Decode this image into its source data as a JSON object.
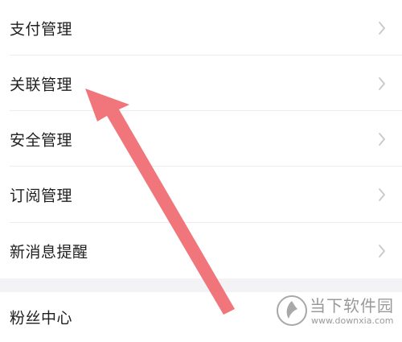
{
  "menu": {
    "items": [
      {
        "label": "支付管理",
        "icon": "chevron-right-icon"
      },
      {
        "label": "关联管理",
        "icon": "chevron-right-icon"
      },
      {
        "label": "安全管理",
        "icon": "chevron-right-icon"
      },
      {
        "label": "订阅管理",
        "icon": "chevron-right-icon"
      },
      {
        "label": "新消息提醒",
        "icon": "chevron-right-icon"
      }
    ],
    "secondary_items": [
      {
        "label": "粉丝中心"
      }
    ]
  },
  "annotation": {
    "icon": "red-arrow-pointer",
    "color": "#f06a70"
  },
  "watermark": {
    "text": "当下软件园",
    "url": "www.downxia.com"
  },
  "colors": {
    "background": "#ffffff",
    "section_gap": "#f3f3f5",
    "text": "#1f1f1f",
    "chevron": "#c8c8c8",
    "divider": "#ececec"
  }
}
